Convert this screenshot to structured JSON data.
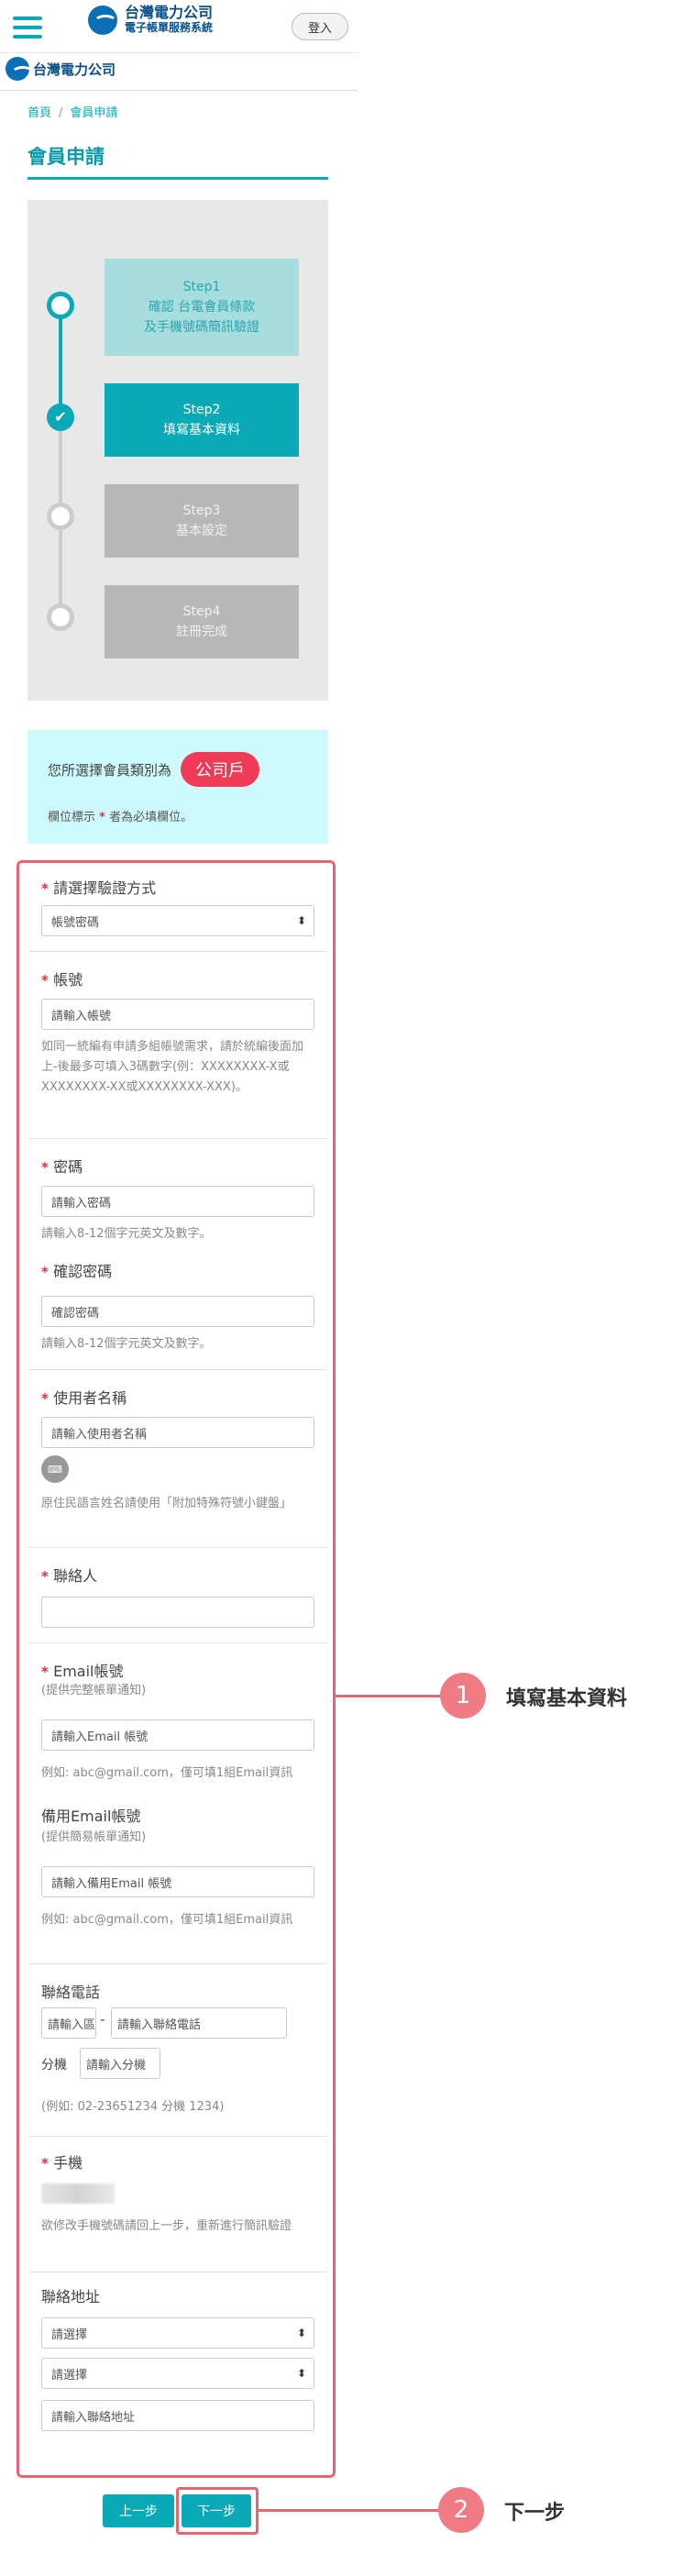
{
  "header": {
    "logo_name": "台灣電力公司",
    "logo_subtitle": "電子帳單服務系統",
    "login_label": "登入",
    "company_logo": "台灣電力公司"
  },
  "breadcrumb": {
    "home": "首頁",
    "separator": "/",
    "current": "會員申請"
  },
  "page_title": "會員申請",
  "steps": [
    {
      "line1": "Step1",
      "line2": "確認 台電會員條款",
      "line3": "及手機號碼簡訊驗證",
      "status": "done"
    },
    {
      "line1": "Step2",
      "line2": "填寫基本資料",
      "status": "active"
    },
    {
      "line1": "Step3",
      "line2": "基本設定",
      "status": "pending"
    },
    {
      "line1": "Step4",
      "line2": "註冊完成",
      "status": "pending"
    }
  ],
  "info": {
    "prefix": "您所選擇會員類別為",
    "member_type": "公司戶",
    "note_before": "欄位標示 ",
    "note_star": "*",
    "note_after": " 者為必填欄位。"
  },
  "form": {
    "verify": {
      "label": "請選擇驗證方式",
      "value": "帳號密碼"
    },
    "account": {
      "label": "帳號",
      "placeholder": "請輸入帳號",
      "hint": "如同一統編有申請多組帳號需求，請於統編後面加上-後最多可填入3碼數字(例：XXXXXXXX-X或XXXXXXXX-XX或XXXXXXXX-XXX)。"
    },
    "password": {
      "label": "密碼",
      "placeholder": "請輸入密碼",
      "hint": "請輸入8-12個字元英文及數字。"
    },
    "confirm": {
      "label": "確認密碼",
      "placeholder": "確認密碼",
      "hint": "請輸入8-12個字元英文及數字。"
    },
    "username": {
      "label": "使用者名稱",
      "placeholder": "請輸入使用者名稱",
      "icon_label": "⌨",
      "hint": "原住民語言姓名請使用「附加特殊符號小鍵盤」"
    },
    "contact": {
      "label": "聯絡人",
      "placeholder": ""
    },
    "email": {
      "label": "Email帳號",
      "sub": "(提供完整帳單通知)",
      "placeholder": "請輸入Email 帳號",
      "hint": "例如: abc@gmail.com，僅可填1組Email資訊"
    },
    "email_backup": {
      "label": "備用Email帳號",
      "sub": "(提供簡易帳單通知)",
      "placeholder": "請輸入備用Email 帳號",
      "hint": "例如: abc@gmail.com，僅可填1組Email資訊"
    },
    "phone": {
      "label": "聯絡電話",
      "area_placeholder": "請輸入區碼",
      "dash": "-",
      "number_placeholder": "請輸入聯絡電話",
      "ext_label": "分機",
      "ext_placeholder": "請輸入分機",
      "hint": "(例如: 02-23651234 分機 1234)"
    },
    "mobile": {
      "label": "手機",
      "hint": "欲修改手機號碼請回上一步，重新進行簡訊驗證"
    },
    "address": {
      "label": "聯絡地址",
      "city": "請選擇",
      "district": "請選擇",
      "placeholder": "請輸入聯絡地址"
    }
  },
  "buttons": {
    "prev": "上一步",
    "next": "下一步"
  },
  "callouts": [
    {
      "number": "1",
      "text": "填寫基本資料"
    },
    {
      "number": "2",
      "text": "下一步"
    }
  ],
  "colors": {
    "accent": "#0aa9b7",
    "highlight": "#e8666f",
    "badge": "#f03a56"
  }
}
